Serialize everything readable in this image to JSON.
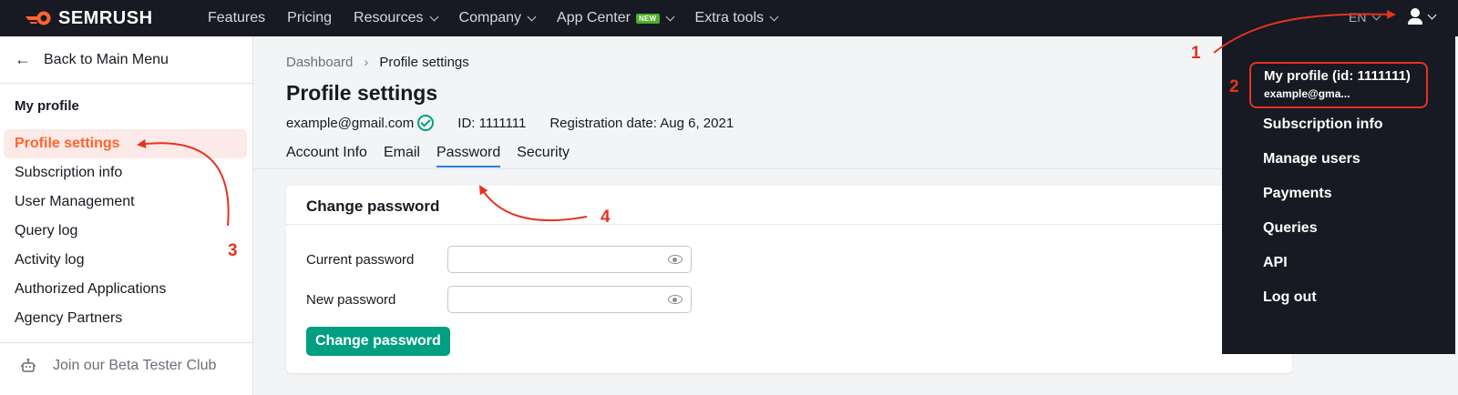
{
  "topnav": {
    "logo": "SEMRUSH",
    "items": [
      {
        "label": "Features",
        "has_chevron": false
      },
      {
        "label": "Pricing",
        "has_chevron": false
      },
      {
        "label": "Resources",
        "has_chevron": true
      },
      {
        "label": "Company",
        "has_chevron": true
      },
      {
        "label": "App Center",
        "has_chevron": true,
        "badge": "NEW"
      },
      {
        "label": "Extra tools",
        "has_chevron": true
      }
    ],
    "lang": "EN"
  },
  "sidebar": {
    "back": "Back to Main Menu",
    "title": "My profile",
    "items": [
      "Profile settings",
      "Subscription info",
      "User Management",
      "Query log",
      "Activity log",
      "Authorized Applications",
      "Agency Partners"
    ],
    "active_index": 0,
    "beta": "Join our Beta Tester Club"
  },
  "main": {
    "breadcrumb": [
      "Dashboard",
      "Profile settings"
    ],
    "title": "Profile settings",
    "email": "example@gmail.com",
    "id_text": "ID: 1111111",
    "registration": "Registration date: Aug 6, 2021",
    "tabs": [
      "Account Info",
      "Email",
      "Password",
      "Security"
    ],
    "active_tab": 2,
    "card": {
      "title": "Change password",
      "current_label": "Current password",
      "new_label": "New password",
      "button": "Change password"
    }
  },
  "dropdown": {
    "profile_name": "My profile (id: 1111111)",
    "profile_email": "example@gma...",
    "items": [
      "Subscription info",
      "Manage users",
      "Payments",
      "Queries",
      "API",
      "Log out"
    ]
  },
  "annotations": [
    "1",
    "2",
    "3",
    "4"
  ],
  "colors": {
    "nav_bg": "#171a22",
    "accent_orange": "#ff642d",
    "annotation_red": "#e8321e",
    "button_green": "#009f81",
    "tab_blue": "#2d7be5"
  }
}
